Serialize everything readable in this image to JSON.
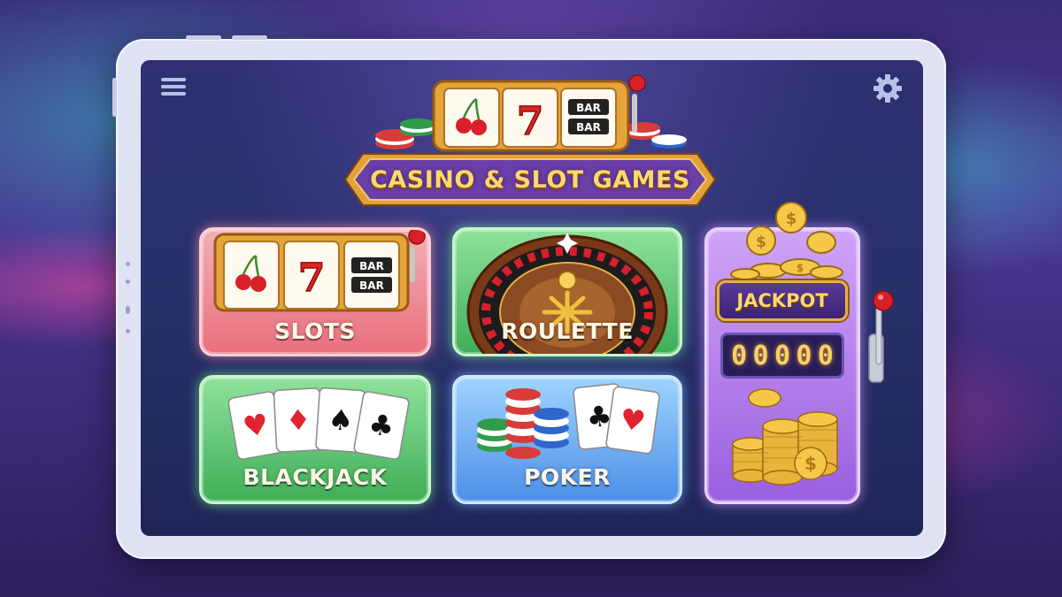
{
  "header": {
    "title": "CASINO & SLOT GAMES"
  },
  "menu": {
    "icon": "hamburger-menu-icon"
  },
  "settings": {
    "icon": "gear-icon"
  },
  "hero_reels": [
    "🍒",
    "7",
    "BAR BAR"
  ],
  "games": [
    {
      "id": "slots",
      "label": "SLOTS",
      "reels": [
        "🍒",
        "7",
        "BAR BAR"
      ]
    },
    {
      "id": "roulette",
      "label": "ROULETTE"
    },
    {
      "id": "blackjack",
      "label": "BLACKJACK",
      "cards": [
        "♥",
        "♦",
        "♠",
        "♣"
      ]
    },
    {
      "id": "poker",
      "label": "POKER",
      "cards": [
        "♣",
        "♥"
      ]
    }
  ],
  "jackpot": {
    "label": "JACKPOT",
    "digits": [
      "0",
      "0",
      "0",
      "0",
      "0"
    ],
    "coin_symbol": "$"
  },
  "colors": {
    "slots": "#ea6f7d",
    "roulette": "#3fae58",
    "blackjack": "#3fae58",
    "poker": "#4c8fe6",
    "jackpot": "#9a5fe0",
    "gold": "#ffd86b"
  }
}
